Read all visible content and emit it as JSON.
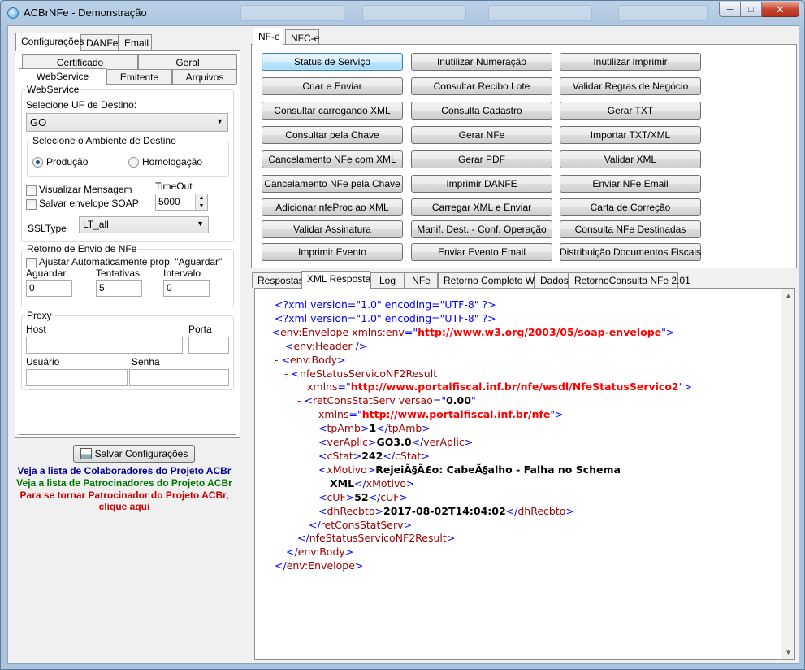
{
  "window": {
    "title": "ACBrNFe - Demonstração"
  },
  "left": {
    "tabs": [
      "Configurações",
      "DANFe",
      "Email"
    ],
    "subtabs_row1": [
      "Certificado",
      "Geral"
    ],
    "subtabs_row2": [
      "WebService",
      "Emitente",
      "Arquivos"
    ],
    "webservice": {
      "group_label": "WebService",
      "uf_label": "Selecione UF de Destino:",
      "uf_value": "GO",
      "ambiente_label": "Selecione o Ambiente de Destino",
      "producao": "Produção",
      "homologacao": "Homologação",
      "visualizar": "Visualizar Mensagem",
      "salvar_soap": "Salvar envelope SOAP",
      "timeout_label": "TimeOut",
      "timeout_value": "5000",
      "ssltype_label": "SSLType",
      "ssltype_value": "LT_all"
    },
    "retorno": {
      "group_label": "Retorno de Envio de NFe",
      "ajustar": "Ajustar Automaticamente prop. \"Aguardar\"",
      "aguardar_label": "Aguardar",
      "aguardar_value": "0",
      "tentativas_label": "Tentativas",
      "tentativas_value": "5",
      "intervalo_label": "Intervalo",
      "intervalo_value": "0"
    },
    "proxy": {
      "group_label": "Proxy",
      "host_label": "Host",
      "porta_label": "Porta",
      "usuario_label": "Usuário",
      "senha_label": "Senha"
    },
    "save_button": "Salvar Configurações",
    "links": {
      "colaboradores": "Veja a lista de Colaboradores do Projeto ACBr",
      "patrocinadores": "Veja a lista de Patrocinadores do Projeto ACBr",
      "patrocinador_1": "Para se tornar Patrocinador do Projeto ACBr,",
      "patrocinador_2": "clique aqui"
    }
  },
  "right": {
    "top_tabs": [
      "NF-e",
      "NFC-e"
    ],
    "buttons": [
      [
        "Status de Serviço",
        "Inutilizar Numeração",
        "Inutilizar Imprimir"
      ],
      [
        "Criar e Enviar",
        "Consultar Recibo Lote",
        "Validar Regras de Negócio"
      ],
      [
        "Consultar carregando XML",
        "Consulta Cadastro",
        "Gerar TXT"
      ],
      [
        "Consultar pela Chave",
        "Gerar NFe",
        "Importar TXT/XML"
      ],
      [
        "Cancelamento NFe com XML",
        "Gerar PDF",
        "Validar XML"
      ],
      [
        "Cancelamento NFe pela Chave",
        "Imprimir DANFE",
        "Enviar NFe Email"
      ],
      [
        "Adicionar nfeProc ao XML",
        "Carregar XML e Enviar",
        "Carta de Correção"
      ],
      [
        "Validar Assinatura",
        "Manif. Dest. - Conf. Operação",
        "Consulta NFe Destinadas"
      ],
      [
        "Imprimir Evento",
        "Enviar Evento Email",
        "Distribuição Documentos Fiscais"
      ]
    ],
    "bottom_tabs": [
      "Respostas",
      "XML Resposta",
      "Log",
      "NFe",
      "Retorno Completo WS",
      "Dados",
      "RetornoConsulta NFe 2.01"
    ],
    "xml": {
      "pi1": "<?xml version=\"1.0\" encoding=\"UTF-8\" ?>",
      "pi2": "<?xml version=\"1.0\" encoding=\"UTF-8\" ?>",
      "envelope_ns": "http://www.w3.org/2003/05/soap-envelope",
      "result_ns": "http://www.portalfiscal.inf.br/nfe/wsdl/NfeStatusServico2",
      "versao": "0.00",
      "ret_ns": "http://www.portalfiscal.inf.br/nfe",
      "tpAmb": "1",
      "verAplic": "GO3.0",
      "cStat": "242",
      "xMotivo_1": "RejeiÃ§Ã£o: CabeÃ§alho - Falha no Schema",
      "xMotivo_2": "XML",
      "cUF": "52",
      "dhRecbto": "2017-08-02T14:04:02"
    }
  }
}
